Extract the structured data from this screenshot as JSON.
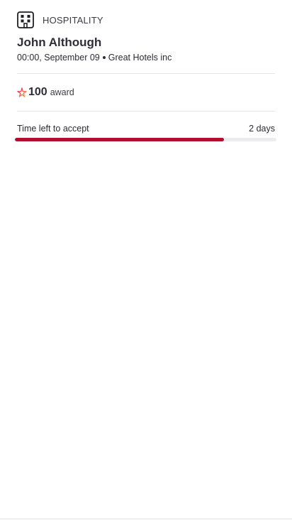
{
  "job": {
    "category": "HOSPITALITY",
    "category_icon": "building-icon",
    "name": "John Although",
    "time": "00:00, September 09",
    "company": "Great Hotels inc"
  },
  "award": {
    "icon": "star-icon",
    "value": "100",
    "label": "award"
  },
  "timer": {
    "label": "Time left to accept",
    "remaining": "2 days",
    "progress_fraction": 0.8
  },
  "colors": {
    "accent": "#b0102e",
    "star_start": "#e8246b",
    "star_end": "#f2a93b",
    "track": "#ececee",
    "divider": "#e4e4e7"
  }
}
